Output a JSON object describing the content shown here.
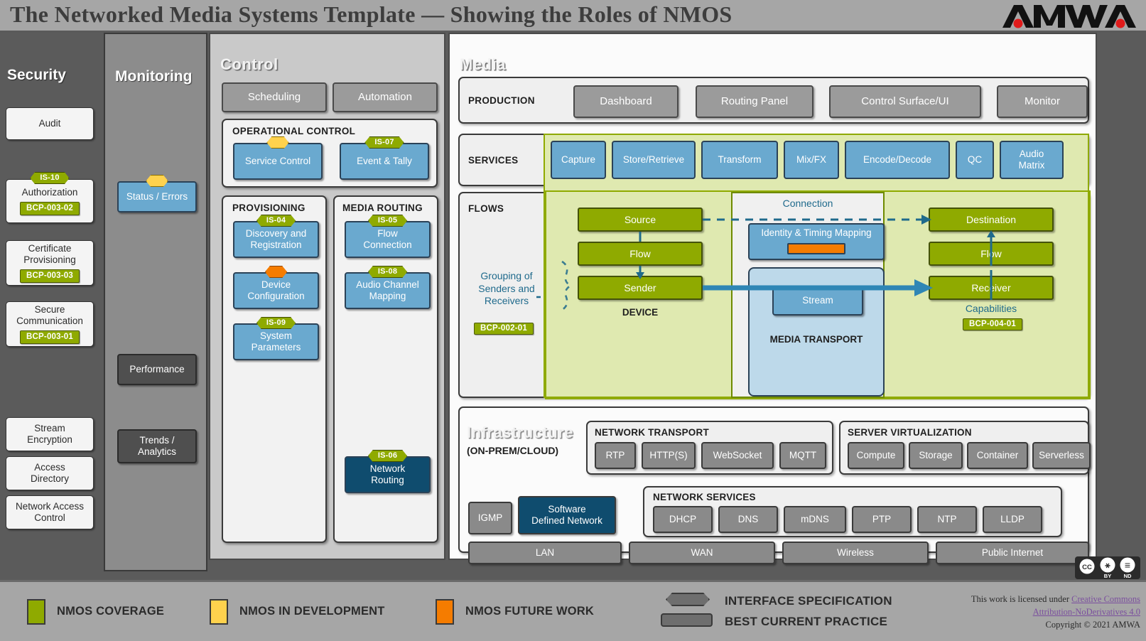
{
  "header": {
    "title": "The Networked Media Systems Template  —  Showing the Roles of NMOS",
    "logo": "AMWA"
  },
  "security": {
    "title": "Security",
    "items": [
      {
        "label": "Audit",
        "is_tag": null,
        "bcp": null
      },
      {
        "label": "Authorization",
        "is_tag": "IS-10",
        "bcp": "BCP-003-02"
      },
      {
        "label": "Certificate\nProvisioning",
        "is_tag": null,
        "bcp": "BCP-003-03"
      },
      {
        "label": "Secure\nCommunication",
        "is_tag": null,
        "bcp": "BCP-003-01"
      },
      {
        "label": "Stream\nEncryption",
        "is_tag": null,
        "bcp": null
      },
      {
        "label": "Access\nDirectory",
        "is_tag": null,
        "bcp": null
      },
      {
        "label": "Network Access\nControl",
        "is_tag": null,
        "bcp": null
      }
    ]
  },
  "monitoring": {
    "title": "Monitoring",
    "items": [
      {
        "label": "Status / Errors",
        "style": "blue",
        "tag": "",
        "tag_state": "in-development"
      },
      {
        "label": "Performance",
        "style": "grey",
        "tag": null
      },
      {
        "label": "Trends /\nAnalytics",
        "style": "grey",
        "tag": null
      }
    ]
  },
  "control": {
    "title": "Control",
    "top_buttons": [
      "Scheduling",
      "Automation"
    ],
    "operational_control": {
      "label": "OPERATIONAL CONTROL",
      "items": [
        {
          "label": "Service Control",
          "tag": "",
          "tag_state": "in-development"
        },
        {
          "label": "Event & Tally",
          "tag": "IS-07",
          "tag_state": "coverage"
        }
      ]
    },
    "provisioning": {
      "label": "PROVISIONING",
      "items": [
        {
          "label": "Discovery and\nRegistration",
          "tag": "IS-04",
          "tag_state": "coverage"
        },
        {
          "label": "Device\nConfiguration",
          "tag": "",
          "tag_state": "future"
        },
        {
          "label": "System\nParameters",
          "tag": "IS-09",
          "tag_state": "coverage"
        }
      ]
    },
    "media_routing": {
      "label": "MEDIA ROUTING",
      "items": [
        {
          "label": "Flow\nConnection",
          "tag": "IS-05",
          "tag_state": "coverage"
        },
        {
          "label": "Audio Channel\nMapping",
          "tag": "IS-08",
          "tag_state": "coverage"
        }
      ],
      "bottom_item": {
        "label": "Network\nRouting",
        "tag": "IS-06",
        "tag_state": "coverage",
        "style": "dark"
      }
    }
  },
  "media": {
    "title": "Media",
    "production": {
      "label": "PRODUCTION",
      "items": [
        "Dashboard",
        "Routing Panel",
        "Control Surface/UI",
        "Monitor"
      ]
    },
    "services": {
      "label": "SERVICES",
      "items": [
        "Capture",
        "Store/Retrieve",
        "Transform",
        "Mix/FX",
        "Encode/Decode",
        "QC",
        "Audio\nMatrix"
      ]
    },
    "flows": {
      "label": "FLOWS",
      "grouping_label": "Grouping of\nSenders and\nReceivers",
      "grouping_bcp": "BCP-002-01",
      "device_label": "DEVICE",
      "device_chain": [
        "Source",
        "Flow",
        "Sender"
      ],
      "connection_label": "Connection",
      "identity_timing_label": "Identity & Timing Mapping",
      "media_transport_label": "MEDIA TRANSPORT",
      "stream_label": "Stream",
      "destination_chain": [
        "Destination",
        "Flow",
        "Receiver"
      ],
      "capabilities_label": "Capabilities",
      "capabilities_bcp": "BCP-004-01"
    }
  },
  "infrastructure": {
    "title": "Infrastructure",
    "subtitle": "(ON-PREM/CLOUD)",
    "network_transport": {
      "label": "NETWORK TRANSPORT",
      "items": [
        "RTP",
        "HTTP(S)",
        "WebSocket",
        "MQTT"
      ]
    },
    "server_virtualization": {
      "label": "SERVER VIRTUALIZATION",
      "items": [
        "Compute",
        "Storage",
        "Container",
        "Serverless"
      ]
    },
    "network_services": {
      "label": "NETWORK SERVICES",
      "items": [
        "DHCP",
        "DNS",
        "mDNS",
        "PTP",
        "NTP",
        "LLDP"
      ]
    },
    "standalone": [
      {
        "label": "IGMP",
        "style": "grey"
      },
      {
        "label": "Software\nDefined Network",
        "style": "navy"
      }
    ],
    "networks": [
      "LAN",
      "WAN",
      "Wireless",
      "Public Internet"
    ]
  },
  "legend": {
    "swatches": [
      {
        "label": "NMOS COVERAGE",
        "color": "#8faa00"
      },
      {
        "label": "NMOS IN DEVELOPMENT",
        "color": "#ffd24d"
      },
      {
        "label": "NMOS FUTURE WORK",
        "color": "#f57c00"
      }
    ],
    "shapes": [
      {
        "label": "INTERFACE SPECIFICATION",
        "shape": "hexagon"
      },
      {
        "label": "BEST CURRENT PRACTICE",
        "shape": "rounded-rect"
      }
    ],
    "license_prefix": "This work is licensed under ",
    "license_link_1": "Creative Commons",
    "license_link_2": "Attribution-NoDerivatives 4.0",
    "copyright": "Copyright © 2021 AMWA",
    "cc_badge": {
      "cc": "CC",
      "by": "BY",
      "nd": "ND"
    }
  },
  "colors": {
    "nmos_coverage": "#8faa00",
    "nmos_in_development": "#ffd24d",
    "nmos_future_work": "#f57c00",
    "blue_box": "#6aa9cf",
    "navy_box": "#0f4c6e",
    "coverage_wash": "#dfe9b0",
    "accent_teal": "#1f6a8c"
  }
}
